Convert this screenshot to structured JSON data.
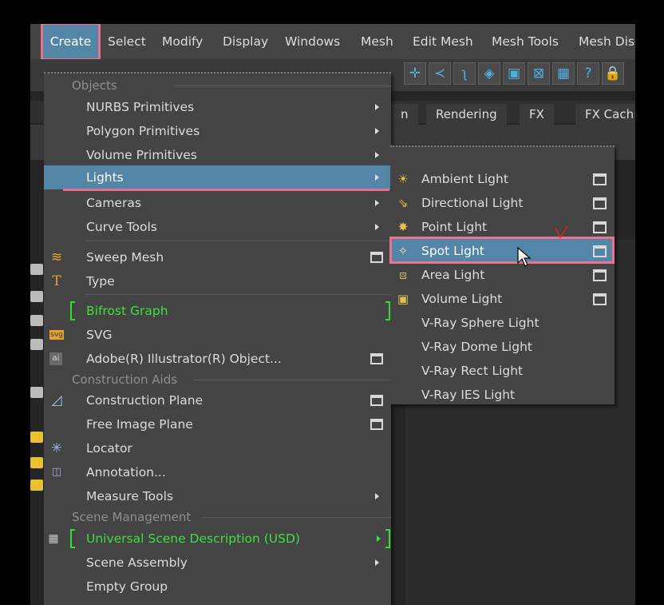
{
  "menubar": {
    "items": [
      "Create",
      "Select",
      "Modify",
      "Display",
      "Windows",
      "Mesh",
      "Edit Mesh",
      "Mesh Tools",
      "Mesh Dis"
    ],
    "active": "Create"
  },
  "shelf_tabs": [
    "n",
    "Rendering",
    "FX",
    "FX Cach"
  ],
  "create_menu": {
    "header_objects": "Objects",
    "nurbs": "NURBS Primitives",
    "polygon": "Polygon Primitives",
    "volume": "Volume Primitives",
    "lights": "Lights",
    "cameras": "Cameras",
    "curve_tools": "Curve Tools",
    "sweep_mesh": "Sweep Mesh",
    "type": "Type",
    "bifrost": "Bifrost Graph",
    "svg": "SVG",
    "illustrator": "Adobe(R) Illustrator(R) Object...",
    "header_construction": "Construction Aids",
    "construction_plane": "Construction Plane",
    "free_image_plane": "Free Image Plane",
    "locator": "Locator",
    "annotation": "Annotation...",
    "measure_tools": "Measure Tools",
    "header_scene": "Scene Management",
    "usd": "Universal Scene Description (USD)",
    "scene_assembly": "Scene Assembly",
    "empty_group": "Empty Group"
  },
  "lights_menu": {
    "ambient": "Ambient Light",
    "directional": "Directional Light",
    "point": "Point Light",
    "spot": "Spot Light",
    "area": "Area Light",
    "volume": "Volume Light",
    "vray_sphere": "V-Ray Sphere Light",
    "vray_dome": "V-Ray Dome Light",
    "vray_rect": "V-Ray Rect Light",
    "vray_ies": "V-Ray IES Light"
  },
  "colors": {
    "highlight": "#5285a6",
    "annotation": "#e9728f",
    "green_text": "#3de03d",
    "menu_bg": "#444444"
  }
}
